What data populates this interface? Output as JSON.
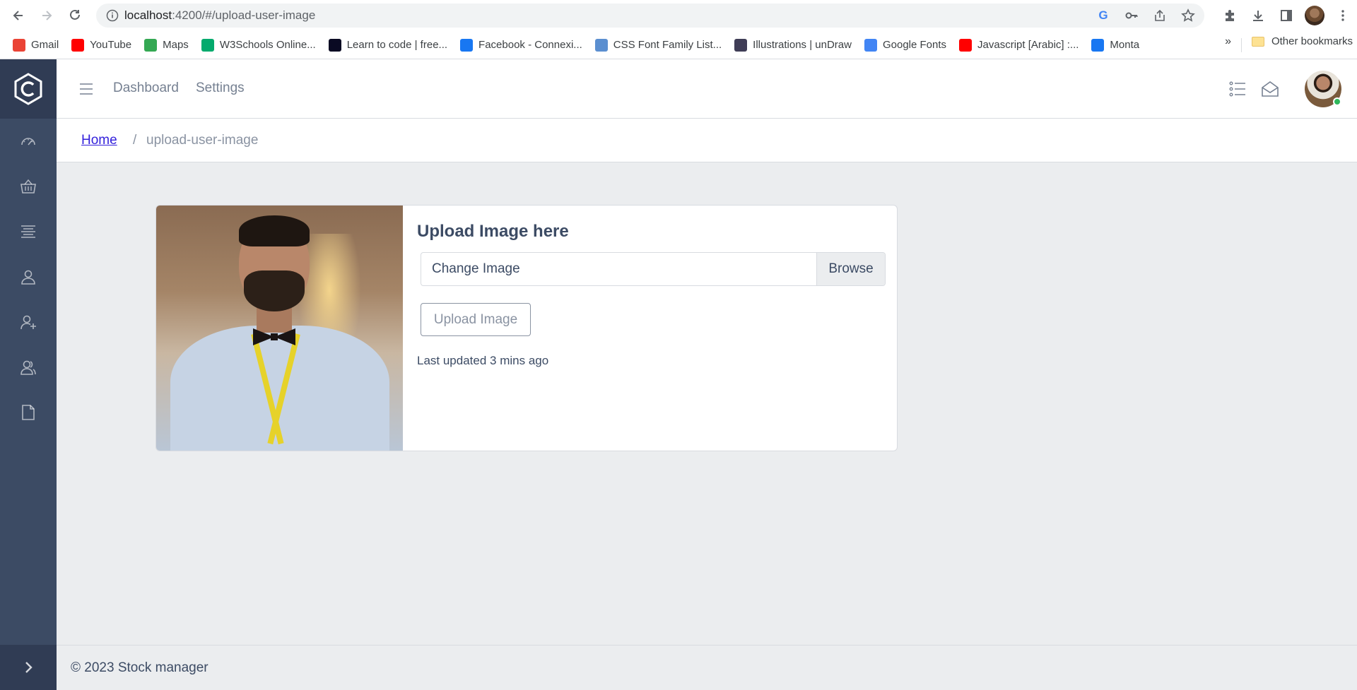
{
  "browser": {
    "url_host": "localhost",
    "url_rest": ":4200/#/upload-user-image",
    "bookmarks": [
      {
        "label": "Gmail",
        "color": "#ea4335",
        "icon": "gmail-icon"
      },
      {
        "label": "YouTube",
        "color": "#ff0000",
        "icon": "youtube-icon"
      },
      {
        "label": "Maps",
        "color": "#34a853",
        "icon": "maps-icon"
      },
      {
        "label": "W3Schools Online...",
        "color": "#04aa6d",
        "icon": "w3schools-icon"
      },
      {
        "label": "Learn to code | free...",
        "color": "#0a0a23",
        "icon": "freecodecamp-icon"
      },
      {
        "label": "Facebook - Connexi...",
        "color": "#1877f2",
        "icon": "facebook-icon"
      },
      {
        "label": "CSS Font Family List...",
        "color": "#5b8fd0",
        "icon": "css-font-icon"
      },
      {
        "label": "Illustrations | unDraw",
        "color": "#3f3d56",
        "icon": "undraw-icon"
      },
      {
        "label": "Google Fonts",
        "color": "#4285f4",
        "icon": "google-fonts-icon"
      },
      {
        "label": "Javascript [Arabic] :...",
        "color": "#ff0000",
        "icon": "youtube-icon"
      },
      {
        "label": "Monta",
        "color": "#1877f2",
        "icon": "facebook-icon"
      }
    ],
    "more_label": "»",
    "other_bookmarks": "Other bookmarks"
  },
  "header": {
    "nav": [
      "Dashboard",
      "Settings"
    ]
  },
  "breadcrumb": {
    "home": "Home",
    "separator": "/",
    "current": "upload-user-image"
  },
  "card": {
    "title": "Upload Image here",
    "file_label": "Change Image",
    "browse": "Browse",
    "upload_button": "Upload Image",
    "updated": "Last updated 3 mins ago"
  },
  "footer": {
    "text": "© 2023 Stock manager"
  },
  "colors": {
    "sidebar": "#3c4b64",
    "sidebar_brand": "#303c54",
    "link": "#321fdb",
    "online": "#2eb85c",
    "page_bg": "#ebedef"
  }
}
